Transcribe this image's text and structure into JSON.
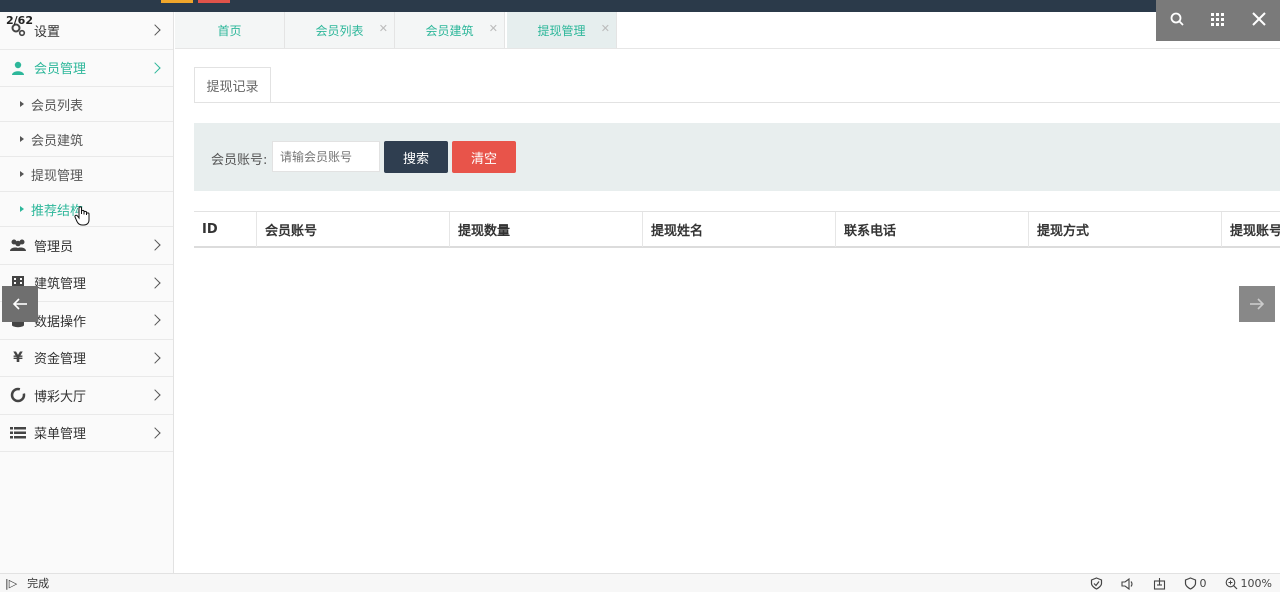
{
  "page_counter": "2/62",
  "sidebar": {
    "items": [
      {
        "label": "设置",
        "icon": "gears-icon"
      },
      {
        "label": "会员管理",
        "icon": "user-icon",
        "active": true,
        "children": [
          {
            "label": "会员列表"
          },
          {
            "label": "会员建筑"
          },
          {
            "label": "提现管理"
          },
          {
            "label": "推荐结构",
            "active": true
          }
        ]
      },
      {
        "label": "管理员",
        "icon": "users-icon"
      },
      {
        "label": "建筑管理",
        "icon": "building-icon"
      },
      {
        "label": "数据操作",
        "icon": "database-icon"
      },
      {
        "label": "资金管理",
        "icon": "yen-icon"
      },
      {
        "label": "博彩大厅",
        "icon": "ring-icon"
      },
      {
        "label": "菜单管理",
        "icon": "list-icon"
      }
    ]
  },
  "tabs": [
    {
      "label": "首页",
      "closable": false
    },
    {
      "label": "会员列表",
      "closable": true
    },
    {
      "label": "会员建筑",
      "closable": true
    },
    {
      "label": "提现管理",
      "closable": true,
      "active": true
    }
  ],
  "tools": {
    "search": "search-icon",
    "grid": "grid-icon",
    "close": "close-icon"
  },
  "content": {
    "subtab": "提现记录",
    "search": {
      "label": "会员账号:",
      "placeholder": "请输会员账号",
      "search_btn": "搜索",
      "clear_btn": "清空"
    },
    "table": {
      "headers": [
        "ID",
        "会员账号",
        "提现数量",
        "提现姓名",
        "联系电话",
        "提现方式",
        "提现账号"
      ]
    }
  },
  "statusbar": {
    "left": "完成",
    "counter": "0",
    "zoom": "100%"
  },
  "colors": {
    "accent": "#2db79a",
    "dark_button": "#2f3e50",
    "danger_button": "#e8544a",
    "topbar": "#2b3a4a"
  }
}
